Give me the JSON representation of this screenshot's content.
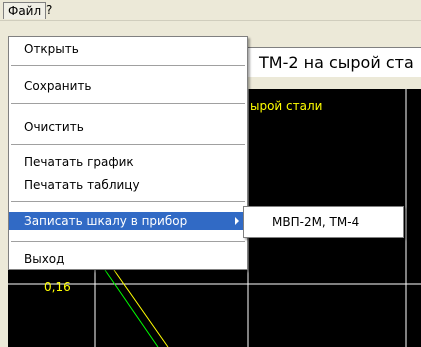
{
  "menubar": {
    "file": "Файл",
    "help": "?"
  },
  "title_field": "ТМ-2 на сырой ста",
  "plot": {
    "title": "ырой стали",
    "ytick": "0,16",
    "colors": {
      "background": "#000000",
      "grid": "#ffffff",
      "series1": "#00ff00",
      "series2": "#ffff00"
    }
  },
  "file_menu": {
    "open": "Открыть",
    "save": "Сохранить",
    "clear": "Очистить",
    "print_chart": "Печатать график",
    "print_table": "Печатать таблицу",
    "write_scale": "Записать шкалу в прибор",
    "exit": "Выход"
  },
  "write_scale_submenu": {
    "device": "МВП-2М, ТМ-4"
  },
  "colors": {
    "highlight": "#316ac5",
    "window": "#ece9d8"
  }
}
